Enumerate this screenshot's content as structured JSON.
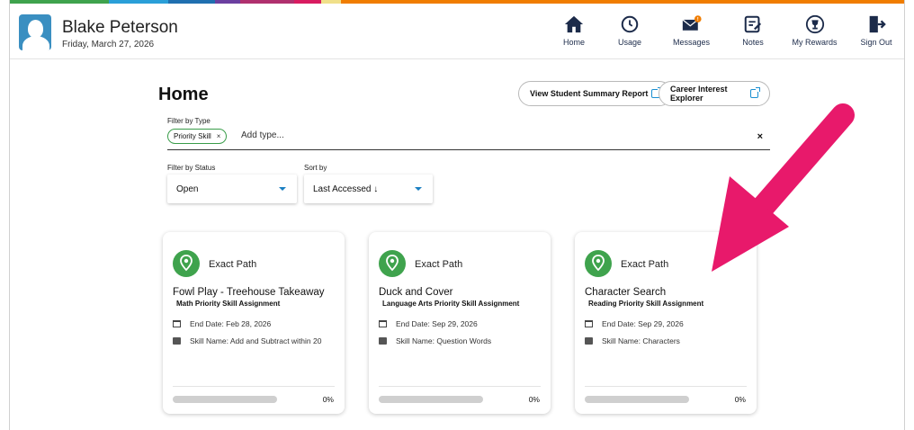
{
  "color_bar": [
    "#3fa34d",
    "#2a9fd8",
    "#6b3fa0",
    "#d81b60",
    "#f5b800",
    "#f0e08a",
    "#f07d00"
  ],
  "user": {
    "name": "Blake Peterson",
    "date": "Friday, March 27, 2026"
  },
  "nav": [
    {
      "label": "Home",
      "icon": "home-icon"
    },
    {
      "label": "Usage",
      "icon": "clock-icon"
    },
    {
      "label": "Messages",
      "icon": "envelope-icon",
      "badge": "!"
    },
    {
      "label": "Notes",
      "icon": "notes-icon"
    },
    {
      "label": "My Rewards",
      "icon": "trophy-icon"
    },
    {
      "label": "Sign Out",
      "icon": "sign-out-icon"
    }
  ],
  "page": {
    "title": "Home",
    "summary_button": "View Student Summary Report",
    "career_button": "Career Interest Explorer"
  },
  "filters": {
    "type_label": "Filter by Type",
    "type_chip": "Priority Skill",
    "type_chip_remove": "×",
    "type_placeholder": "Add type...",
    "type_clear": "×",
    "status_label": "Filter by Status",
    "status_value": "Open",
    "sort_label": "Sort by",
    "sort_value": "Last Accessed ↓"
  },
  "cards": [
    {
      "brand": "Exact Path",
      "title": "Fowl Play - Treehouse Takeaway",
      "subtitle": "Math Priority Skill Assignment",
      "end_date": "End Date: Feb 28, 2026",
      "skill": "Skill Name: Add and Subtract within 20",
      "progress_text": "0%",
      "progress": 0
    },
    {
      "brand": "Exact Path",
      "title": "Duck and Cover",
      "subtitle": "Language Arts Priority Skill Assignment",
      "end_date": "End Date: Sep 29, 2026",
      "skill": "Skill Name: Question Words",
      "progress_text": "0%",
      "progress": 0
    },
    {
      "brand": "Exact Path",
      "title": "Character Search",
      "subtitle": "Reading Priority Skill Assignment",
      "end_date": "End Date: Sep 29, 2026",
      "skill": "Skill Name: Characters",
      "progress_text": "0%",
      "progress": 0
    }
  ],
  "colors": {
    "accent_green": "#3fa34d",
    "navy": "#1c2b4a",
    "link_blue": "#1a8fd1",
    "annotation_pink": "#e8196b"
  }
}
